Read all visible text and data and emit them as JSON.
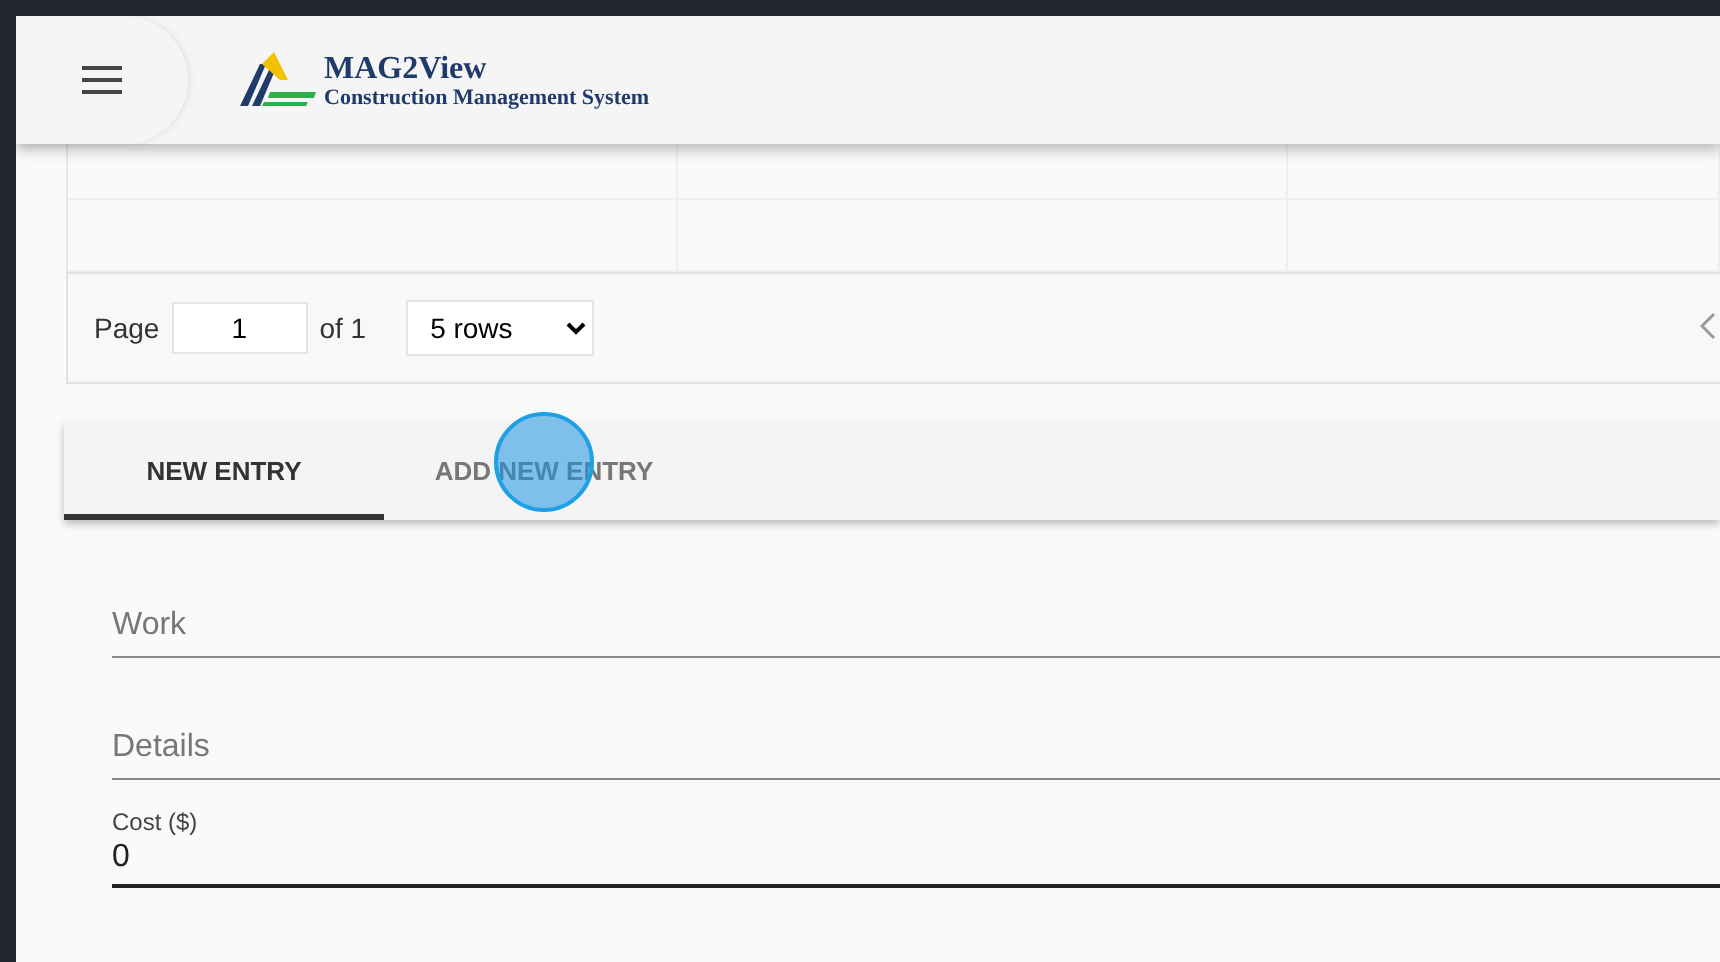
{
  "header": {
    "title": "MAG2View",
    "subtitle": "Construction Management System"
  },
  "pagination": {
    "page_label": "Page",
    "page_value": "1",
    "of_label": "of 1",
    "rows_option": "5 rows"
  },
  "tabs": [
    {
      "label": "NEW ENTRY",
      "selected": true
    },
    {
      "label": "ADD NEW ENTRY",
      "selected": false
    }
  ],
  "fields": [
    {
      "placeholder": "Work"
    },
    {
      "placeholder": "Details"
    },
    {
      "label": "Cost ($)",
      "value": "0",
      "focused": true
    }
  ]
}
